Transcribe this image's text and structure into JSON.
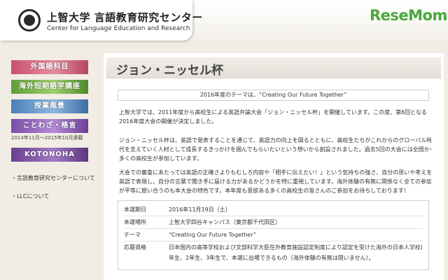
{
  "header": {
    "title": "上智大学 言語教育研究センター",
    "subtitle": "Center for Language Education and Research",
    "brand": "ReseMom"
  },
  "sidebar": {
    "banners": [
      {
        "label": "外国語科目"
      },
      {
        "label": "海外短期語学講座"
      },
      {
        "label": "授業風景"
      },
      {
        "label": "ことわざ・格言"
      },
      {
        "label": "KOTONOHA"
      }
    ],
    "banner_note": "2014年11月～2015年10月連載",
    "links": [
      "・言語教育研究センターについて",
      "・LLCについて"
    ]
  },
  "main": {
    "title": "ジョン・ニッセル杯",
    "theme": "2016年度のテーマは、“Creating Our Future Together”",
    "paragraphs": [
      [
        "上智大学では、2011年度から高校生による英語弁論大会「ジョン・ニッセル杯」を開催しています。この度、第6回となる",
        "2016年度大会の開催が決定しました。"
      ],
      [
        "ジョン・ニッセル杯は、英語で発表することを通じて、英語力の向上を図るとともに、高校生たちがこれからのグローバル時",
        "代を支えていく人材として成長するきっかけを掴んでもらいたいという想いから創設されました。過去5回の大会には全国から",
        "多くの高校生が参加しています。"
      ],
      [
        "大会での審査にあたっては英語の正確さよりもむしろ内容や「相手に伝えたい！」という気持ちの強さ、自分の思いや考えを",
        "英語で表現し、自分の言葉で聞き手に届ける力があるかどうかを特に重視しています。海外体験の有無に関係なく全ての参加者",
        "が平等に競い合うのも本大会の特色です。本年度も意欲ある多くの高校生の皆さんのご参加をお待ちしております！"
      ]
    ],
    "info": [
      {
        "label": "本選期日",
        "value": [
          "2016年11月19日（土）"
        ]
      },
      {
        "label": "本選場所",
        "value": [
          "上智大学四谷キャンパス（東京都千代田区）"
        ]
      },
      {
        "label": "テーマ",
        "value": [
          "“Creating Our Future Together”"
        ]
      },
      {
        "label": "応募資格",
        "value": [
          "日本国内の高等学校および文部科学大臣在外教育施設認定制度により認定を受けた海外の日本人学校に通う1",
          "年生、2年生、3年生で、本選に出場できるもの（海外体験の有無は問いません）。"
        ]
      }
    ]
  },
  "colors": {
    "background": "#f2ede4",
    "brand_green": "#4aa83c",
    "accent_red": "#b03030"
  }
}
